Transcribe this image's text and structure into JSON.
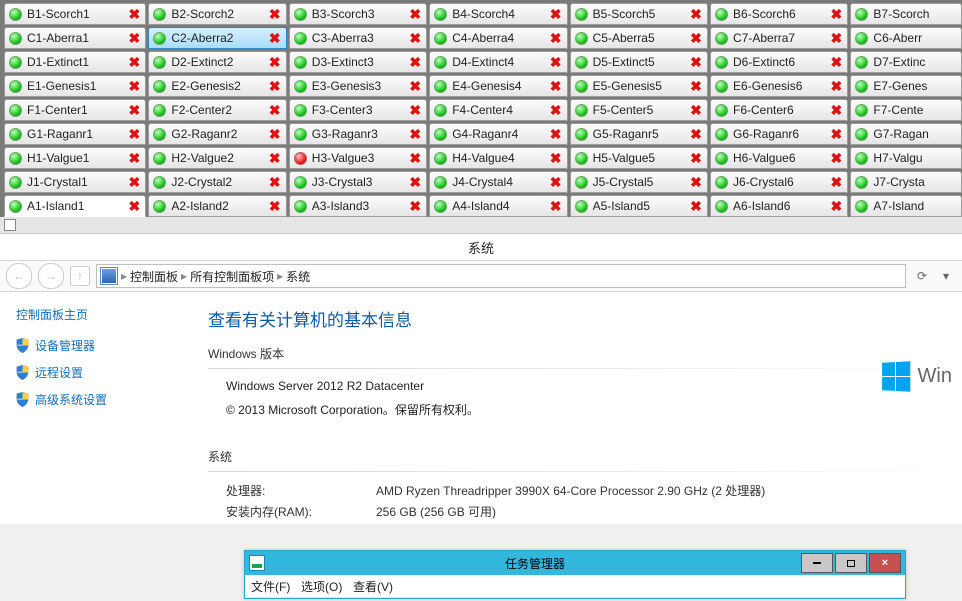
{
  "tabs": {
    "cols": 7,
    "rows": [
      [
        {
          "label": "B1-Scorch1"
        },
        {
          "label": "B2-Scorch2"
        },
        {
          "label": "B3-Scorch3"
        },
        {
          "label": "B4-Scorch4"
        },
        {
          "label": "B5-Scorch5"
        },
        {
          "label": "B6-Scorch6"
        },
        {
          "label": "B7-Scorch",
          "clipped": true
        }
      ],
      [
        {
          "label": "C1-Aberra1"
        },
        {
          "label": "C2-Aberra2",
          "selected": true
        },
        {
          "label": "C3-Aberra3"
        },
        {
          "label": "C4-Aberra4"
        },
        {
          "label": "C5-Aberra5"
        },
        {
          "label": "C7-Aberra7"
        },
        {
          "label": "C6-Aberr",
          "clipped": true
        }
      ],
      [
        {
          "label": "D1-Extinct1"
        },
        {
          "label": "D2-Extinct2"
        },
        {
          "label": "D3-Extinct3"
        },
        {
          "label": "D4-Extinct4"
        },
        {
          "label": "D5-Extinct5"
        },
        {
          "label": "D6-Extinct6"
        },
        {
          "label": "D7-Extinc",
          "clipped": true
        }
      ],
      [
        {
          "label": "E1-Genesis1"
        },
        {
          "label": "E2-Genesis2"
        },
        {
          "label": "E3-Genesis3"
        },
        {
          "label": "E4-Genesis4"
        },
        {
          "label": "E5-Genesis5"
        },
        {
          "label": "E6-Genesis6"
        },
        {
          "label": "E7-Genes",
          "clipped": true
        }
      ],
      [
        {
          "label": "F1-Center1"
        },
        {
          "label": "F2-Center2"
        },
        {
          "label": "F3-Center3"
        },
        {
          "label": "F4-Center4"
        },
        {
          "label": "F5-Center5"
        },
        {
          "label": "F6-Center6"
        },
        {
          "label": "F7-Cente",
          "clipped": true
        }
      ],
      [
        {
          "label": "G1-Raganr1"
        },
        {
          "label": "G2-Raganr2"
        },
        {
          "label": "G3-Raganr3"
        },
        {
          "label": "G4-Raganr4"
        },
        {
          "label": "G5-Raganr5"
        },
        {
          "label": "G6-Raganr6"
        },
        {
          "label": "G7-Ragan",
          "clipped": true
        }
      ],
      [
        {
          "label": "H1-Valgue1"
        },
        {
          "label": "H2-Valgue2"
        },
        {
          "label": "H3-Valgue3",
          "led": "red"
        },
        {
          "label": "H4-Valgue4"
        },
        {
          "label": "H5-Valgue5"
        },
        {
          "label": "H6-Valgue6"
        },
        {
          "label": "H7-Valgu",
          "clipped": true
        }
      ],
      [
        {
          "label": "J1-Crystal1"
        },
        {
          "label": "J2-Crystal2"
        },
        {
          "label": "J3-Crystal3"
        },
        {
          "label": "J4-Crystal4"
        },
        {
          "label": "J5-Crystal5"
        },
        {
          "label": "J6-Crystal6"
        },
        {
          "label": "J7-Crysta",
          "clipped": true
        }
      ],
      [
        {
          "label": "A1-Island1",
          "active": true
        },
        {
          "label": "A2-Island2"
        },
        {
          "label": "A3-Island3"
        },
        {
          "label": "A4-Island4"
        },
        {
          "label": "A5-Island5"
        },
        {
          "label": "A6-Island6"
        },
        {
          "label": "A7-Island",
          "clipped": true
        }
      ]
    ]
  },
  "system_window": {
    "title": "系统",
    "breadcrumb": [
      "控制面板",
      "所有控制面板项",
      "系统"
    ],
    "sidebar": {
      "heading": "控制面板主页",
      "links": [
        "设备管理器",
        "远程设置",
        "高级系统设置"
      ]
    },
    "main": {
      "heading": "查看有关计算机的基本信息",
      "edition_head": "Windows 版本",
      "edition_line": "Windows Server 2012 R2 Datacenter",
      "copyright": "© 2013 Microsoft Corporation。保留所有权利。",
      "logo_text": "Win",
      "system_head": "系统",
      "cpu_label": "处理器:",
      "cpu_value": "AMD Ryzen Threadripper 3990X 64-Core Processor    2.90 GHz  (2 处理器)",
      "ram_label": "安装内存(RAM):",
      "ram_value": "256 GB (256 GB 可用)"
    }
  },
  "task_manager": {
    "title": "任务管理器",
    "menu": [
      "文件(F)",
      "选项(O)",
      "查看(V)"
    ]
  }
}
